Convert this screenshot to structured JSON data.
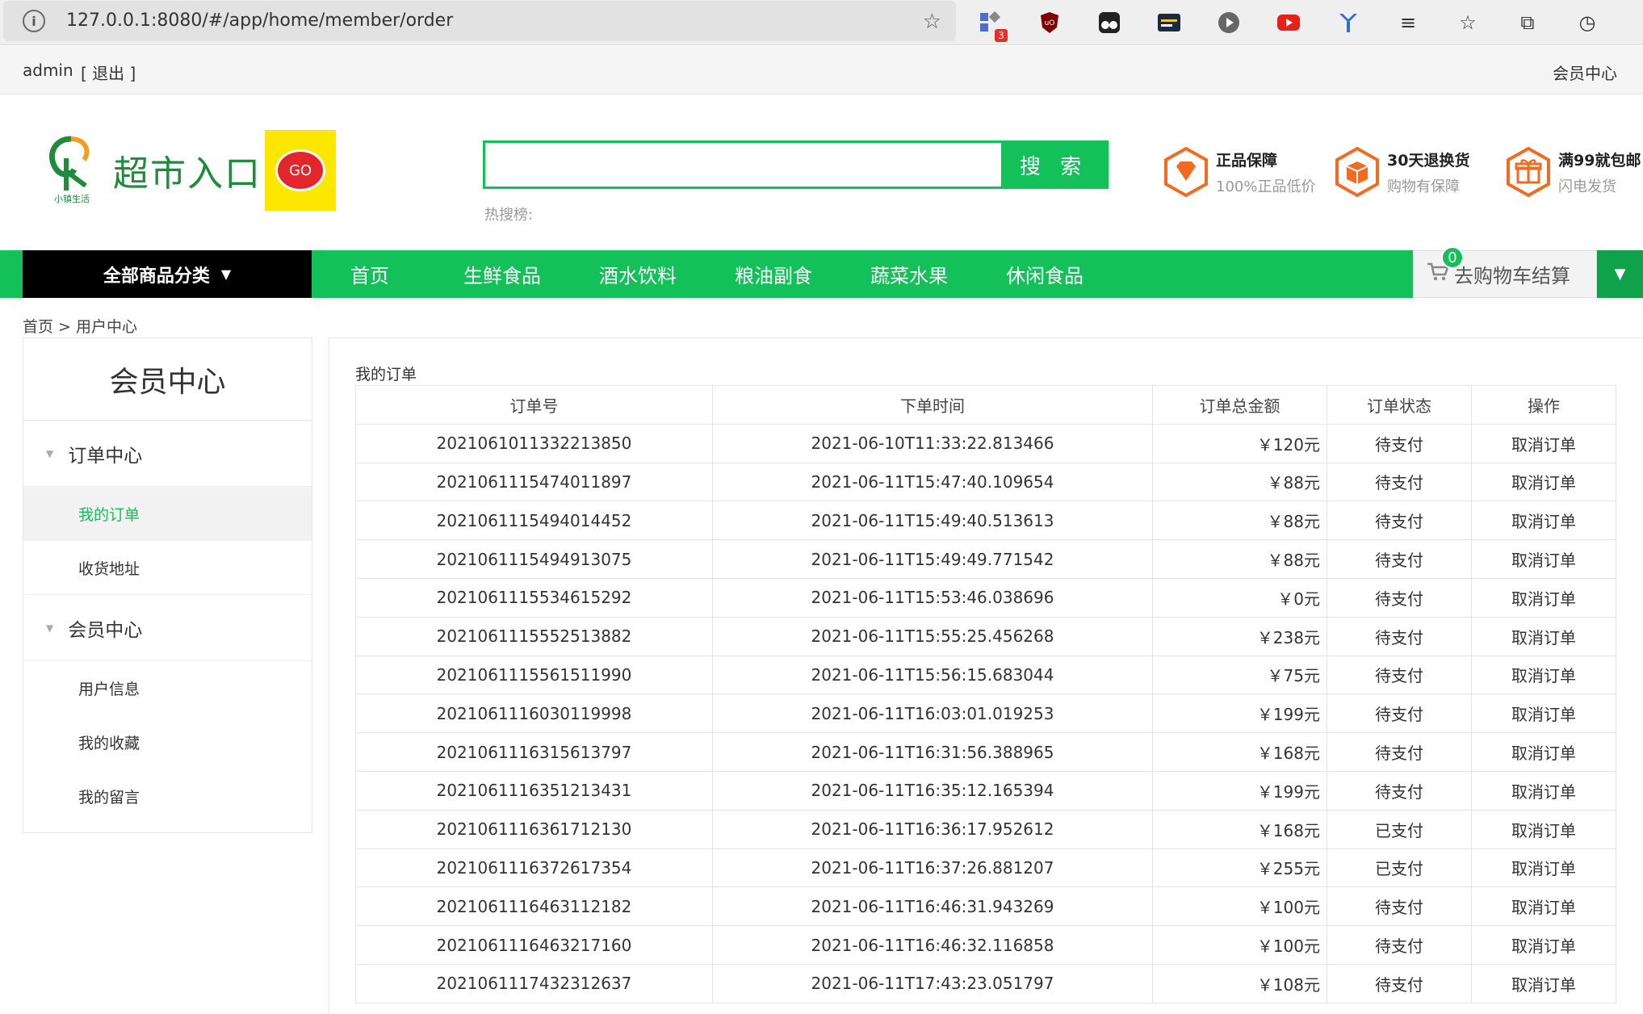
{
  "browser": {
    "url": "127.0.0.1:8080/#/app/home/member/order",
    "extension_badge": "3"
  },
  "topbar": {
    "username": "admin",
    "logout_label": "[ 退出 ]",
    "member_center_label": "会员中心"
  },
  "header": {
    "logo_text": "超市入口",
    "logo_brand": "小镇生活",
    "logo_go": "GO",
    "search_placeholder": "",
    "search_button": "搜 索",
    "hot_search_label": "热搜榜:",
    "guarantees": [
      {
        "title": "正品保障",
        "sub": "100%正品低价",
        "icon": "diamond-icon"
      },
      {
        "title": "30天退换货",
        "sub": "购物有保障",
        "icon": "box-icon"
      },
      {
        "title": "满99就包邮",
        "sub": "闪电发货",
        "icon": "gift-icon"
      }
    ]
  },
  "nav": {
    "all_categories": "全部商品分类",
    "items": [
      "首页",
      "生鲜食品",
      "酒水饮料",
      "粮油副食",
      "蔬菜水果",
      "休闲食品"
    ],
    "cart_label": "去购物车结算",
    "cart_count": "0"
  },
  "breadcrumb": "首页 > 用户中心",
  "sidebar": {
    "title": "会员中心",
    "groups": [
      {
        "label": "订单中心",
        "items": [
          "我的订单",
          "收货地址"
        ]
      },
      {
        "label": "会员中心",
        "items": [
          "用户信息",
          "我的收藏",
          "我的留言"
        ]
      }
    ],
    "active_item": "我的订单"
  },
  "orders": {
    "title": "我的订单",
    "columns": [
      "订单号",
      "下单时间",
      "订单总金额",
      "订单状态",
      "操作"
    ],
    "rows": [
      {
        "no": "2021061011332213850",
        "time": "2021-06-10T11:33:22.813466",
        "amount": "￥120元",
        "status": "待支付",
        "op": "取消订单"
      },
      {
        "no": "2021061115474011897",
        "time": "2021-06-11T15:47:40.109654",
        "amount": "￥88元",
        "status": "待支付",
        "op": "取消订单"
      },
      {
        "no": "2021061115494014452",
        "time": "2021-06-11T15:49:40.513613",
        "amount": "￥88元",
        "status": "待支付",
        "op": "取消订单"
      },
      {
        "no": "2021061115494913075",
        "time": "2021-06-11T15:49:49.771542",
        "amount": "￥88元",
        "status": "待支付",
        "op": "取消订单"
      },
      {
        "no": "2021061115534615292",
        "time": "2021-06-11T15:53:46.038696",
        "amount": "￥0元",
        "status": "待支付",
        "op": "取消订单"
      },
      {
        "no": "2021061115552513882",
        "time": "2021-06-11T15:55:25.456268",
        "amount": "￥238元",
        "status": "待支付",
        "op": "取消订单"
      },
      {
        "no": "2021061115561511990",
        "time": "2021-06-11T15:56:15.683044",
        "amount": "￥75元",
        "status": "待支付",
        "op": "取消订单"
      },
      {
        "no": "2021061116030119998",
        "time": "2021-06-11T16:03:01.019253",
        "amount": "￥199元",
        "status": "待支付",
        "op": "取消订单"
      },
      {
        "no": "2021061116315613797",
        "time": "2021-06-11T16:31:56.388965",
        "amount": "￥168元",
        "status": "待支付",
        "op": "取消订单"
      },
      {
        "no": "2021061116351213431",
        "time": "2021-06-11T16:35:12.165394",
        "amount": "￥199元",
        "status": "待支付",
        "op": "取消订单"
      },
      {
        "no": "2021061116361712130",
        "time": "2021-06-11T16:36:17.952612",
        "amount": "￥168元",
        "status": "已支付",
        "op": "取消订单"
      },
      {
        "no": "2021061116372617354",
        "time": "2021-06-11T16:37:26.881207",
        "amount": "￥255元",
        "status": "已支付",
        "op": "取消订单"
      },
      {
        "no": "2021061116463112182",
        "time": "2021-06-11T16:46:31.943269",
        "amount": "￥100元",
        "status": "待支付",
        "op": "取消订单"
      },
      {
        "no": "2021061116463217160",
        "time": "2021-06-11T16:46:32.116858",
        "amount": "￥100元",
        "status": "待支付",
        "op": "取消订单"
      },
      {
        "no": "2021061117432312637",
        "time": "2021-06-11T17:43:23.051797",
        "amount": "￥108元",
        "status": "待支付",
        "op": "取消订单"
      }
    ]
  },
  "colors": {
    "brand_green": "#13c05a",
    "nav_black": "#000000",
    "accent_orange": "#f36b21"
  }
}
